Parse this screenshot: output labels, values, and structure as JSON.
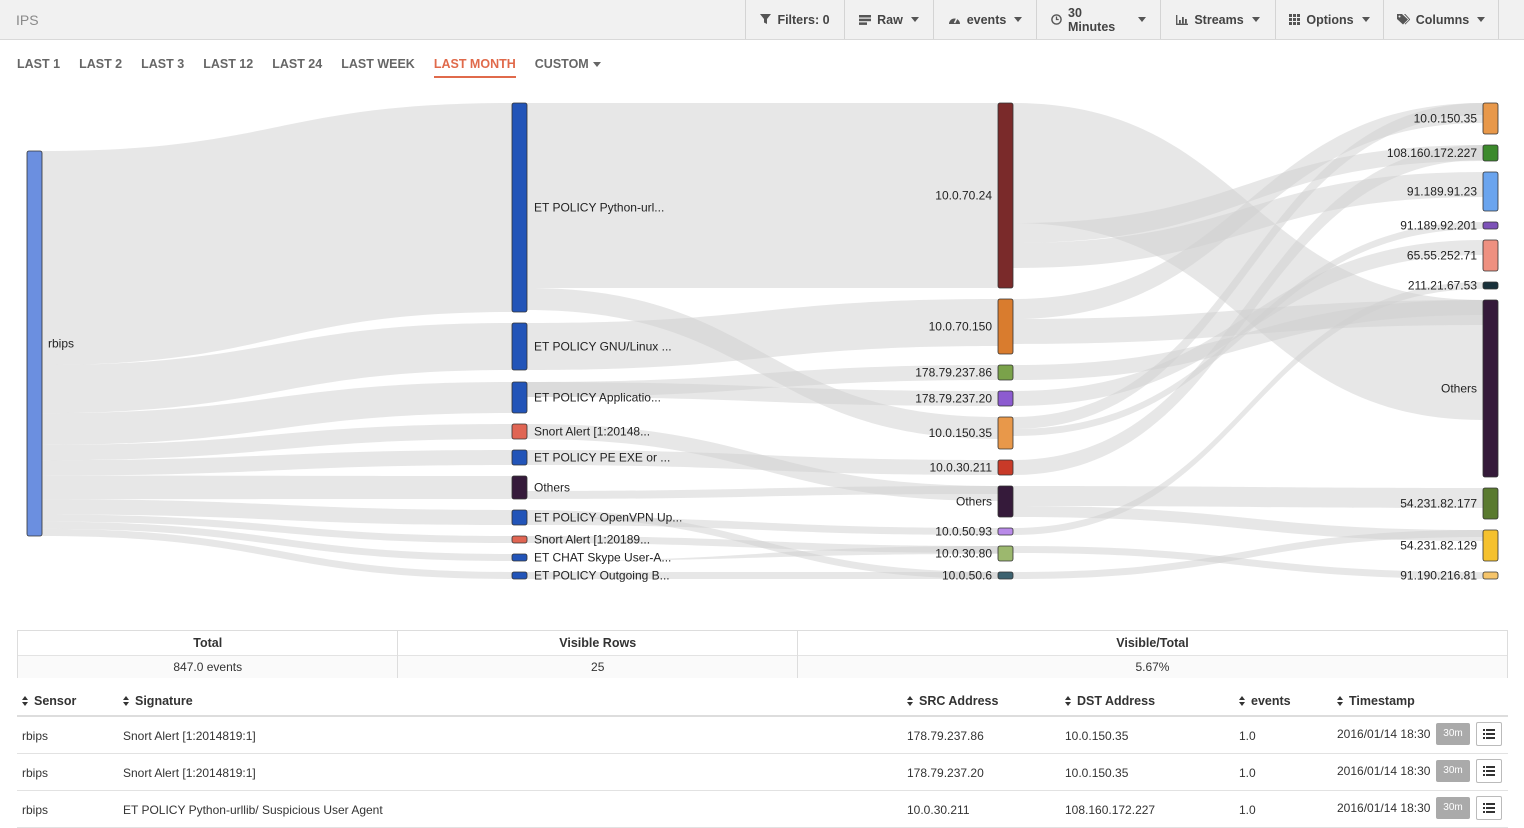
{
  "app": {
    "title": "IPS"
  },
  "toolbar": [
    {
      "name": "filters-button",
      "icon": "filter-icon",
      "label": "Filters: 0",
      "dropdown": false
    },
    {
      "name": "raw-button",
      "icon": "table-icon",
      "label": "Raw",
      "dropdown": true
    },
    {
      "name": "events-button",
      "icon": "gauge-icon",
      "label": "events",
      "dropdown": true
    },
    {
      "name": "time-button",
      "icon": "clock-icon",
      "label": "30 Minutes",
      "dropdown": true
    },
    {
      "name": "streams-button",
      "icon": "bar-chart-icon",
      "label": "Streams",
      "dropdown": true
    },
    {
      "name": "options-button",
      "icon": "grid-icon",
      "label": "Options",
      "dropdown": true
    },
    {
      "name": "columns-button",
      "icon": "tags-icon",
      "label": "Columns",
      "dropdown": true
    }
  ],
  "ranges": [
    "LAST 1",
    "LAST 2",
    "LAST 3",
    "LAST 12",
    "LAST 24",
    "LAST WEEK",
    "LAST MONTH",
    "CUSTOM"
  ],
  "active_range": "LAST MONTH",
  "sankey": {
    "columns": [
      [
        {
          "label": "rbips",
          "color": "#6b8fe0"
        }
      ],
      [
        {
          "label": "ET POLICY Python-url...",
          "color": "#2254b8"
        },
        {
          "label": "ET POLICY GNU/Linux ...",
          "color": "#2254b8"
        },
        {
          "label": "ET POLICY Applicatio...",
          "color": "#2254b8"
        },
        {
          "label": "Snort Alert [1:20148...",
          "color": "#e06553"
        },
        {
          "label": "ET POLICY PE EXE or ...",
          "color": "#2254b8"
        },
        {
          "label": "Others",
          "color": "#351a3a"
        },
        {
          "label": "ET POLICY OpenVPN Up...",
          "color": "#2254b8"
        },
        {
          "label": "Snort Alert [1:20189...",
          "color": "#e06553"
        },
        {
          "label": "ET CHAT Skype User-A...",
          "color": "#2254b8"
        },
        {
          "label": "ET POLICY Outgoing B...",
          "color": "#2254b8"
        }
      ],
      [
        {
          "label": "10.0.70.24",
          "color": "#7a2a2a"
        },
        {
          "label": "10.0.70.150",
          "color": "#d97c2e"
        },
        {
          "label": "178.79.237.86",
          "color": "#7aa24a"
        },
        {
          "label": "178.79.237.20",
          "color": "#8c5bd0"
        },
        {
          "label": "10.0.150.35",
          "color": "#e8984a"
        },
        {
          "label": "10.0.30.211",
          "color": "#c83a28"
        },
        {
          "label": "Others",
          "color": "#351a3a"
        },
        {
          "label": "10.0.50.93",
          "color": "#b98ae8"
        },
        {
          "label": "10.0.30.80",
          "color": "#9cb86e"
        },
        {
          "label": "10.0.50.6",
          "color": "#3d6270"
        }
      ],
      [
        {
          "label": "10.0.150.35",
          "color": "#e8984a"
        },
        {
          "label": "108.160.172.227",
          "color": "#3c8a2c"
        },
        {
          "label": "91.189.91.23",
          "color": "#6aa4ee"
        },
        {
          "label": "91.189.92.201",
          "color": "#7d52b8"
        },
        {
          "label": "65.55.252.71",
          "color": "#ee9080"
        },
        {
          "label": "211.21.67.53",
          "color": "#18303a"
        },
        {
          "label": "Others",
          "color": "#351a3a"
        },
        {
          "label": "54.231.82.177",
          "color": "#5a7a30"
        },
        {
          "label": "54.231.82.129",
          "color": "#f5c12e"
        },
        {
          "label": "91.190.216.81",
          "color": "#f5c46a"
        }
      ]
    ]
  },
  "stats": {
    "total_label": "Total",
    "total_value": "847.0 events",
    "visible_label": "Visible Rows",
    "visible_value": "25",
    "ratio_label": "Visible/Total",
    "ratio_value": "5.67%"
  },
  "table": {
    "columns": [
      "Sensor",
      "Signature",
      "SRC Address",
      "DST Address",
      "events",
      "Timestamp"
    ],
    "zoom_label": "30m",
    "rows": [
      {
        "sensor": "rbips",
        "signature": "Snort Alert [1:2014819:1]",
        "src": "178.79.237.86",
        "dst": "10.0.150.35",
        "events": "1.0",
        "timestamp": "2016/01/14 18:30"
      },
      {
        "sensor": "rbips",
        "signature": "Snort Alert [1:2014819:1]",
        "src": "178.79.237.20",
        "dst": "10.0.150.35",
        "events": "1.0",
        "timestamp": "2016/01/14 18:30"
      },
      {
        "sensor": "rbips",
        "signature": "ET POLICY Python-urllib/ Suspicious User Agent",
        "src": "10.0.30.211",
        "dst": "108.160.172.227",
        "events": "1.0",
        "timestamp": "2016/01/14 18:30"
      }
    ]
  }
}
